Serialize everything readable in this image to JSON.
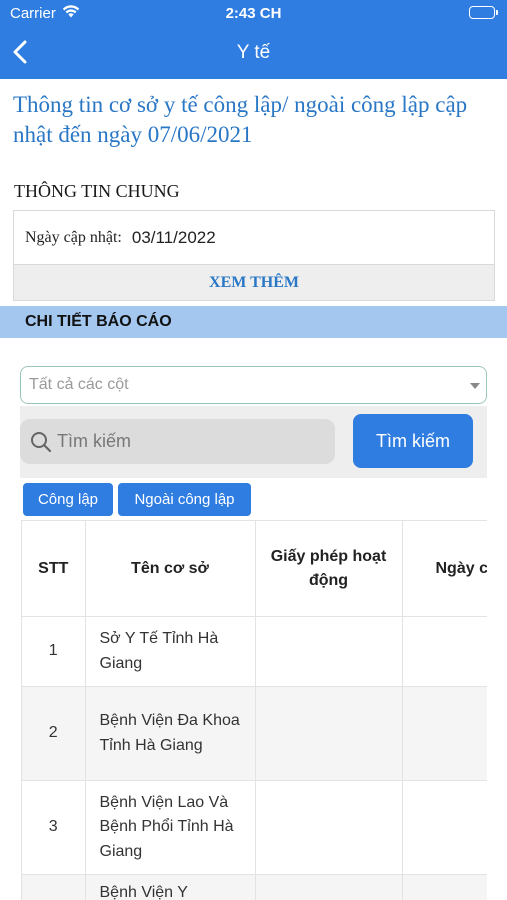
{
  "status": {
    "carrier": "Carrier",
    "time": "2:43 CH"
  },
  "nav": {
    "title": "Y tế"
  },
  "headline": "Thông tin cơ sở y tế công lập/ ngoài công lập cập nhật đến ngày 07/06/2021",
  "general": {
    "title": "THÔNG TIN CHUNG",
    "updated_label": "Ngày cập nhật:",
    "updated_value": "03/11/2022",
    "more_label": "XEM THÊM"
  },
  "report": {
    "title": "CHI TIẾT BÁO CÁO"
  },
  "filter": {
    "column_placeholder": "Tất cả các cột",
    "search_placeholder": "Tìm kiếm",
    "search_button": "Tìm kiếm"
  },
  "tabs": [
    "Công lập",
    "Ngoài công lập"
  ],
  "table": {
    "headers": [
      "STT",
      "Tên cơ sở",
      "Giấy phép hoạt động",
      "Ngày c"
    ],
    "rows": [
      {
        "stt": "1",
        "name": "Sở Y Tế Tỉnh Hà Giang"
      },
      {
        "stt": "2",
        "name": "Bệnh Viện Đa Khoa Tỉnh Hà Giang"
      },
      {
        "stt": "3",
        "name": "Bệnh Viện Lao Và Bệnh Phổi Tỉnh Hà Giang"
      },
      {
        "stt": "",
        "name": "Bệnh Viện Y"
      }
    ]
  },
  "colors": {
    "primary": "#2f7de1",
    "report_bar": "#a4c7f0",
    "link": "#2a77c6"
  }
}
